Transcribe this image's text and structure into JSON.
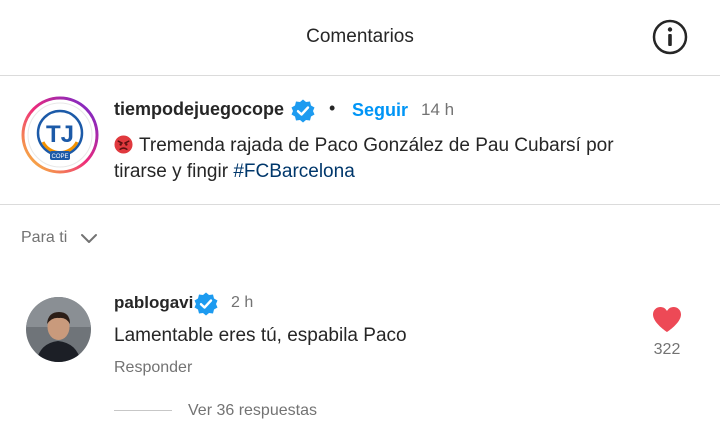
{
  "header": {
    "title": "Comentarios",
    "info_icon": "info-circle-icon"
  },
  "post": {
    "avatar_text": "TJ",
    "avatar_subtext": "COPE",
    "username": "tiempodejuegocope",
    "verified_icon": "verified-badge-icon",
    "separator": "•",
    "follow_label": "Seguir",
    "time": "14 h",
    "emoji": "angry-face-emoji",
    "caption_text": "Tremenda rajada de Paco González de Pau Cubarsí por tirarse y fingir",
    "hashtag": "#FCBarcelona"
  },
  "filter": {
    "label": "Para ti",
    "icon": "chevron-down-icon"
  },
  "comment": {
    "username": "pablogavi",
    "verified_icon": "verified-badge-icon",
    "time": "2 h",
    "text": "Lamentable eres tú, espabila Paco",
    "reply_label": "Responder",
    "like_icon": "heart-icon",
    "likes": "322",
    "view_replies_label": "Ver 36 respuestas"
  },
  "colors": {
    "accent": "#0095f6",
    "heart": "#ed4956",
    "hashtag": "#00376b",
    "divider": "#dbdbdb"
  }
}
